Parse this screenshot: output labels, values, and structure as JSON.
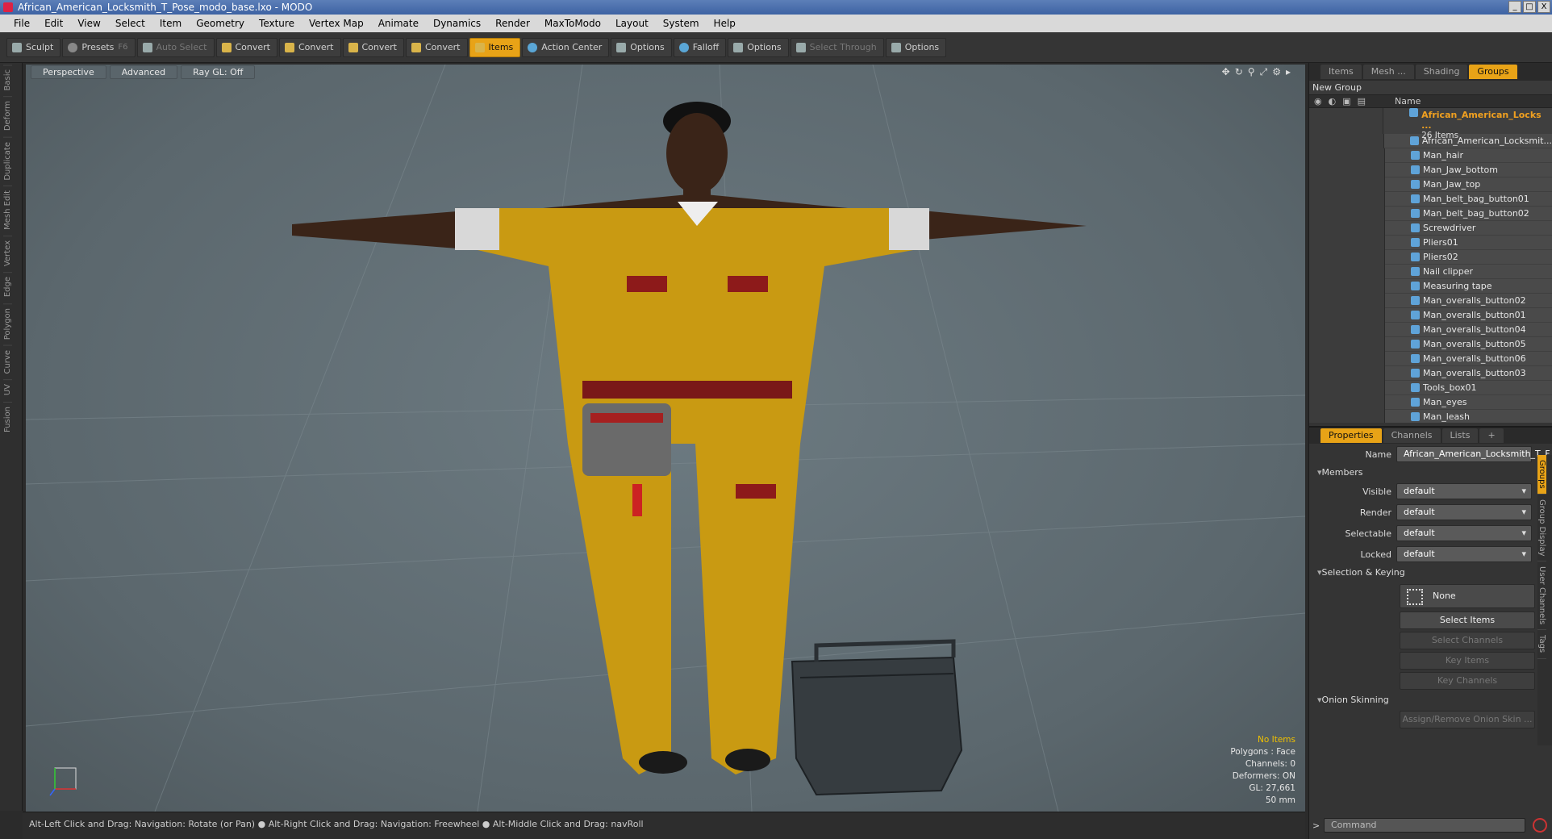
{
  "window": {
    "title": "African_American_Locksmith_T_Pose_modo_base.lxo - MODO",
    "controls": [
      "_",
      "□",
      "X"
    ]
  },
  "menu": [
    "File",
    "Edit",
    "View",
    "Select",
    "Item",
    "Geometry",
    "Texture",
    "Vertex Map",
    "Animate",
    "Dynamics",
    "Render",
    "MaxToModo",
    "Layout",
    "System",
    "Help"
  ],
  "toolbar": {
    "sculpt": "Sculpt",
    "presets": "Presets",
    "presets_key": "F6",
    "auto_select": "Auto Select",
    "convert": "Convert",
    "items": "Items",
    "action_center": "Action Center",
    "options": "Options",
    "falloff": "Falloff",
    "select_through": "Select Through"
  },
  "left_tabs": [
    "Basic",
    "Deform",
    "Duplicate",
    "Mesh Edit",
    "Vertex",
    "Edge",
    "Polygon",
    "Curve",
    "UV",
    "Fusion"
  ],
  "viewport": {
    "view": "Perspective",
    "shading": "Advanced",
    "raygl": "Ray GL: Off",
    "stats": {
      "items": "No Items",
      "polygons": "Polygons : Face",
      "channels": "Channels: 0",
      "deformers": "Deformers: ON",
      "gl": "GL: 27,661",
      "focal": "50 mm"
    }
  },
  "status": "Alt-Left Click and Drag: Navigation: Rotate (or Pan) ● Alt-Right Click and Drag: Navigation: Freewheel ● Alt-Middle Click and Drag: navRoll",
  "groups_panel": {
    "tabs": [
      "Items",
      "Mesh ...",
      "Shading",
      "Groups"
    ],
    "new_group": "New Group",
    "col_name": "Name",
    "group_name": "African_American_Locks ...",
    "group_count": "26 Items",
    "members": [
      "African_American_Locksmit...",
      "Man_hair",
      "Man_Jaw_bottom",
      "Man_Jaw_top",
      "Man_belt_bag_button01",
      "Man_belt_bag_button02",
      "Screwdriver",
      "Pliers01",
      "Pliers02",
      "Nail clipper",
      "Measuring tape",
      "Man_overalls_button02",
      "Man_overalls_button01",
      "Man_overalls_button04",
      "Man_overalls_button05",
      "Man_overalls_button06",
      "Man_overalls_button03",
      "Tools_box01",
      "Man_eyes",
      "Man_leash"
    ]
  },
  "properties": {
    "tabs": [
      "Properties",
      "Channels",
      "Lists",
      "+"
    ],
    "name_label": "Name",
    "name_value": "African_American_Locksmith_T_F",
    "members_section": "Members",
    "visible_label": "Visible",
    "render_label": "Render",
    "selectable_label": "Selectable",
    "locked_label": "Locked",
    "default": "default",
    "selkey_section": "Selection & Keying",
    "none": "None",
    "select_items": "Select Items",
    "select_channels": "Select Channels",
    "key_items": "Key Items",
    "key_channels": "Key Channels",
    "onion_section": "Onion Skinning",
    "assign_onion": "Assign/Remove Onion Skin ...",
    "side_tabs": [
      "Groups",
      "Group Display",
      "User Channels",
      "Tags"
    ]
  },
  "command": {
    "prompt": ">",
    "placeholder": "Command"
  }
}
